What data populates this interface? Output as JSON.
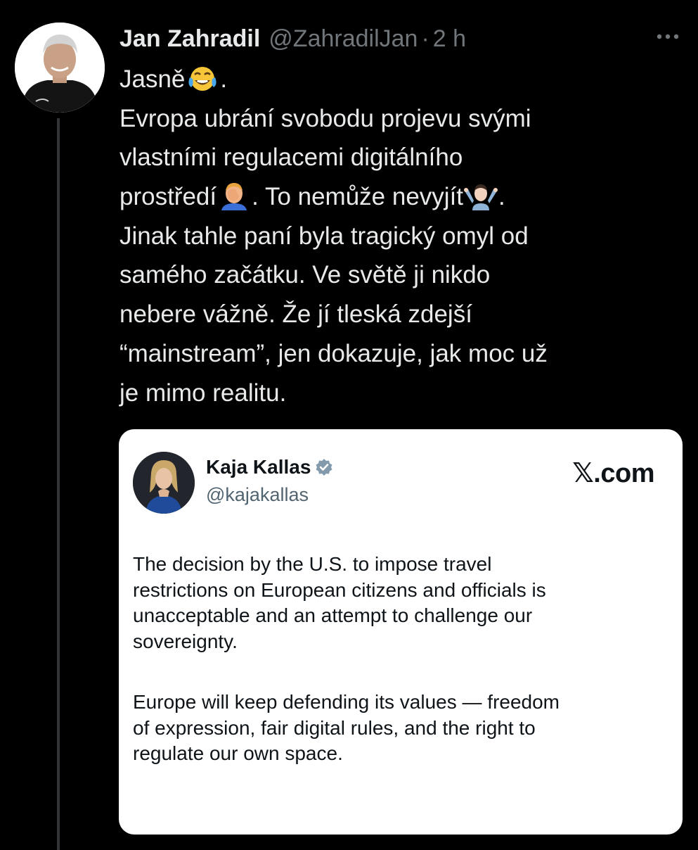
{
  "tweet": {
    "author_name": "Jan Zahradil",
    "author_handle": "@ZahradilJan",
    "separator": "·",
    "time": "2 h",
    "more_label": "···",
    "lines": {
      "l1": "Jasně",
      "l1_end": ".",
      "l2": "Evropa ubrání svobodu projevu svými",
      "l3": "vlastními regulacemi digitálního",
      "l4a": "prostředí",
      "l4b": ". To nemůže nevyjít",
      "l4c": ".",
      "l5": "Jinak tahle paní byla tragický omyl od",
      "l6": "samého začátku. Ve světě ji nikdo",
      "l7": "nebere vážně. Že jí tleská zdejší",
      "l8": "“mainstream”, jen dokazuje, jak moc už",
      "l9": "je mimo realitu."
    },
    "emojis": [
      "face-with-tears-of-joy",
      "person-facepalming",
      "person-shrugging"
    ]
  },
  "quote": {
    "author_name": "Kaja Kallas",
    "author_handle": "@kajakallas",
    "brand": "𝕏.com",
    "verified_color": "#829aab",
    "paragraph1": [
      "The decision by the U.S. to impose travel",
      "restrictions on European citizens and officials is",
      "unacceptable and an attempt to challenge our",
      "sovereignty."
    ],
    "paragraph2": [
      "Europe will keep defending its values — freedom",
      "of expression, fair digital rules, and the right to",
      "regulate our own space."
    ]
  },
  "colors": {
    "background": "#000000",
    "text": "#e7e9ea",
    "secondary": "#71767b",
    "card_background": "#ffffff",
    "card_text": "#0f1419"
  }
}
